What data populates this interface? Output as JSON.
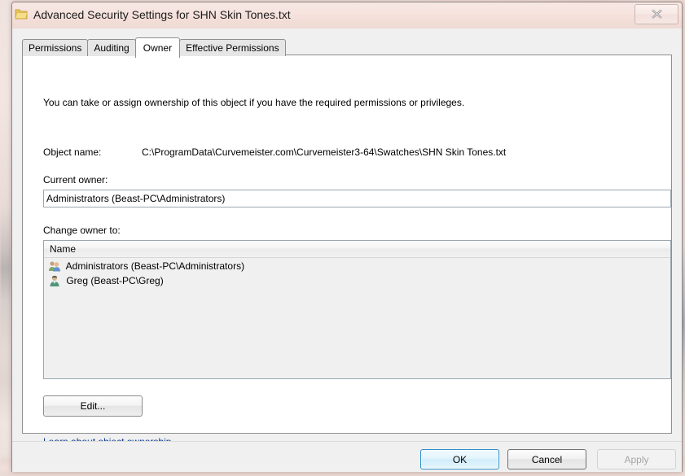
{
  "window": {
    "title": "Advanced Security Settings for SHN Skin Tones.txt",
    "icon": "folder-icon",
    "close_label": "close-icon"
  },
  "tabs": [
    {
      "label": "Permissions",
      "selected": false
    },
    {
      "label": "Auditing",
      "selected": false
    },
    {
      "label": "Owner",
      "selected": true
    },
    {
      "label": "Effective Permissions",
      "selected": false
    }
  ],
  "owner_page": {
    "intro_text": "You can take or assign ownership of this object if you have the required permissions or privileges.",
    "object_name_label": "Object name:",
    "object_name_value": "C:\\ProgramData\\Curvemeister.com\\Curvemeister3-64\\Swatches\\SHN Skin Tones.txt",
    "current_owner_label": "Current owner:",
    "current_owner_value": "Administrators (Beast-PC\\Administrators)",
    "change_owner_label": "Change owner to:",
    "list": {
      "columns": [
        "Name"
      ],
      "rows": [
        {
          "name": "Administrators (Beast-PC\\Administrators)",
          "icon": "group-users-icon"
        },
        {
          "name": "Greg (Beast-PC\\Greg)",
          "icon": "single-user-icon"
        }
      ]
    },
    "edit_label": "Edit...",
    "learn_link_label": "Learn about object ownership"
  },
  "footer": {
    "ok_label": "OK",
    "cancel_label": "Cancel",
    "apply_label": "Apply",
    "apply_enabled": false
  },
  "colors": {
    "titlebar": "#f4e0db",
    "accent_focus": "#2c8fc9",
    "link": "#0b3c91",
    "dialog_bg": "#f0f0f0",
    "disabled_text": "#a6a6a6"
  }
}
